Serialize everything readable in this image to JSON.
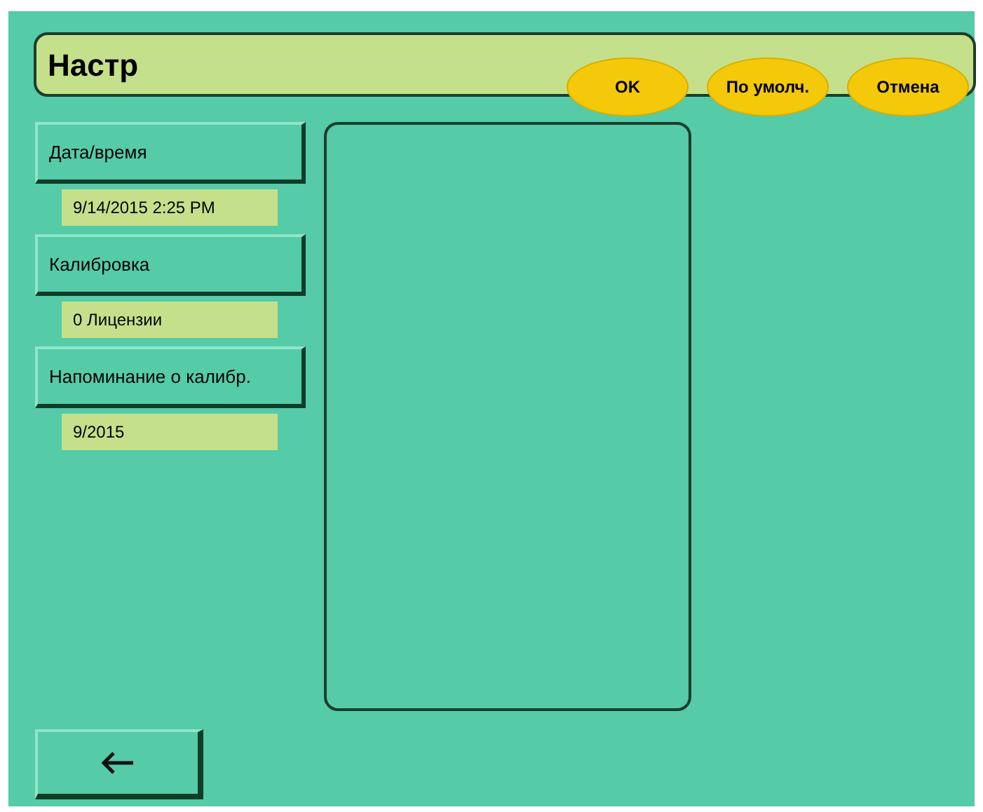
{
  "header": {
    "title": "Настр"
  },
  "buttons": [
    "OK",
    "По умолч.",
    "Отмена"
  ],
  "settings": [
    {
      "label": "Дата/время",
      "value": "9/14/2015 2:25 PM"
    },
    {
      "label": "Калибровка",
      "value": "0 Лицензии"
    },
    {
      "label": "Напоминание о калибр.",
      "value": "9/2015"
    }
  ]
}
